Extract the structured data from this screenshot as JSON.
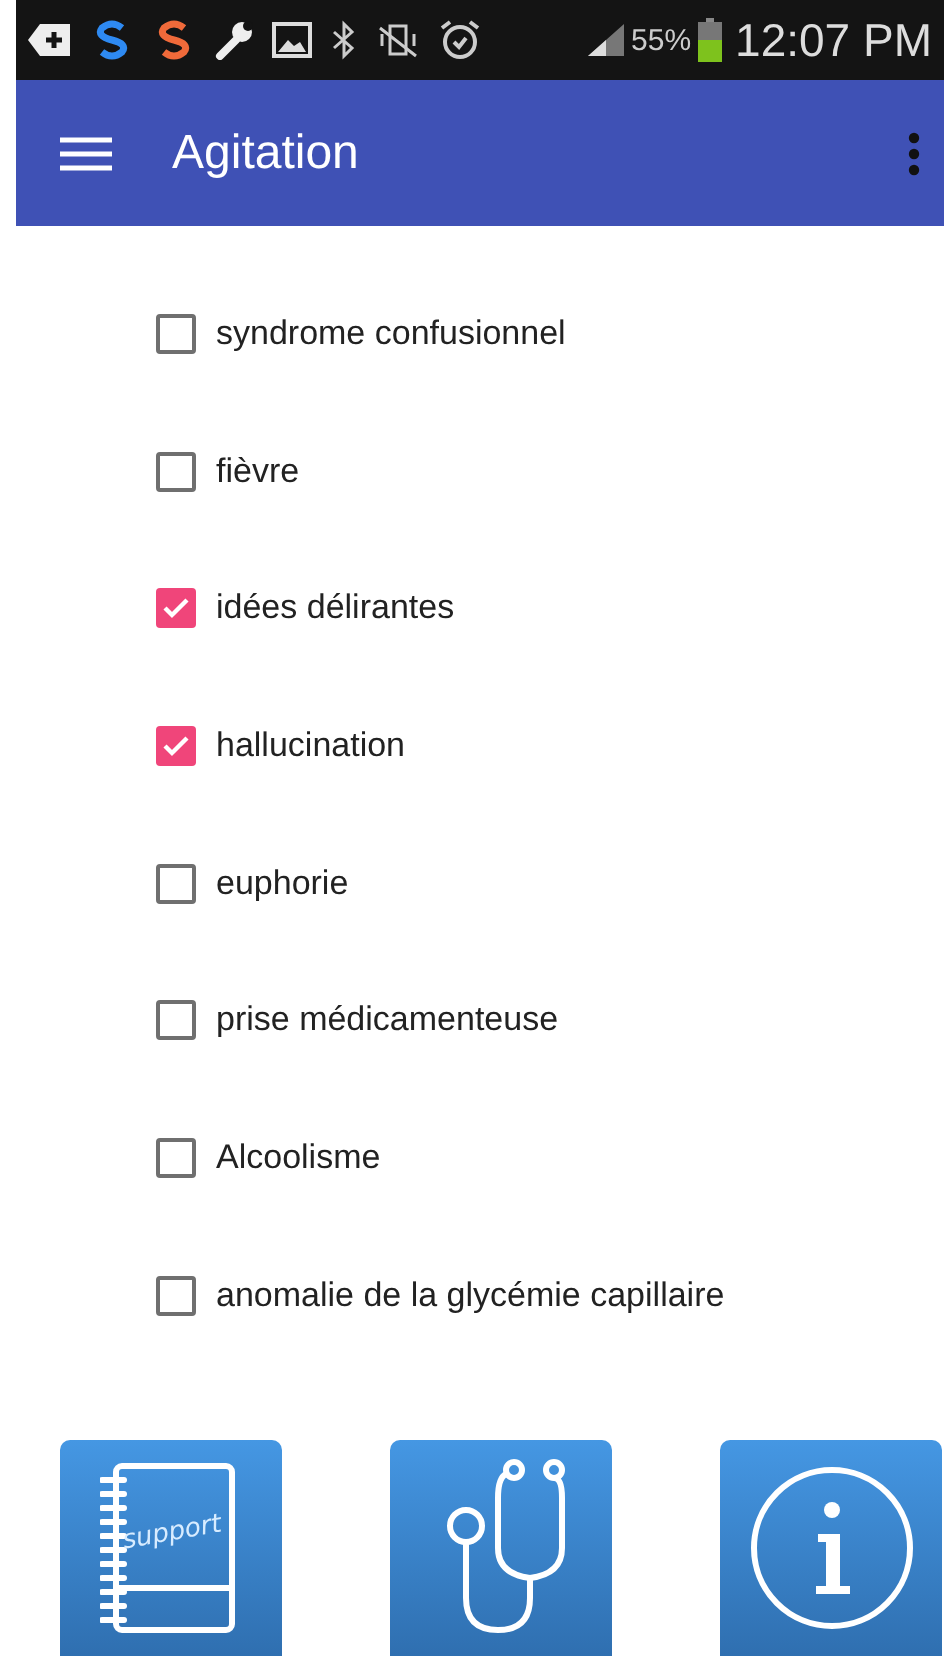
{
  "status_bar": {
    "battery": "55%",
    "time": "12:07 PM"
  },
  "app_bar": {
    "title": "Agitation"
  },
  "symptoms": [
    {
      "label": "syndrome confusionnel",
      "checked": false
    },
    {
      "label": "fièvre",
      "checked": false
    },
    {
      "label": "idées délirantes",
      "checked": true
    },
    {
      "label": "hallucination",
      "checked": true
    },
    {
      "label": "euphorie",
      "checked": false
    },
    {
      "label": "prise médicamenteuse",
      "checked": false
    },
    {
      "label": "Alcoolisme",
      "checked": false
    },
    {
      "label": "anomalie de la glycémie capillaire",
      "checked": false
    }
  ],
  "bottom_buttons": [
    {
      "kind": "notebook",
      "label": "support"
    },
    {
      "kind": "stethoscope"
    },
    {
      "kind": "info"
    }
  ]
}
